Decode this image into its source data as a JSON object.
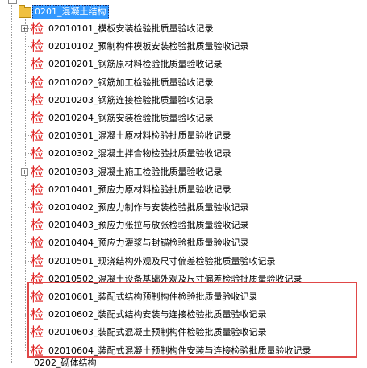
{
  "tree": {
    "parent": {
      "label": "0201_混凝土结构",
      "selected": true
    },
    "icon_char": "检",
    "items": [
      {
        "label": "02010101_模板安装检验批质量验收记录",
        "expander": "+"
      },
      {
        "label": "02010102_预制构件模板安装检验批质量验收记录"
      },
      {
        "label": "02010201_钢筋原材料检验批质量验收记录"
      },
      {
        "label": "02010202_钢筋加工检验批质量验收记录"
      },
      {
        "label": "02010203_钢筋连接检验批质量验收记录"
      },
      {
        "label": "02010204_钢筋安装检验批质量验收记录"
      },
      {
        "label": "02010301_混凝土原材料检验批质量验收记录"
      },
      {
        "label": "02010302_混凝土拌合物检验批质量验收记录"
      },
      {
        "label": "02010303_混凝土施工检验批质量验收记录",
        "expander": "+"
      },
      {
        "label": "02010401_预应力原材料检验批质量验收记录"
      },
      {
        "label": "02010402_预应力制作与安装检验批质量验收记录"
      },
      {
        "label": "02010403_预应力张拉与放张检验批质量验收记录"
      },
      {
        "label": "02010404_预应力灌浆与封锚检验批质量验收记录"
      },
      {
        "label": "02010501_现浇结构外观及尺寸偏差检验批质量验收记录"
      },
      {
        "label": "02010502_混凝土设备基础外观及尺寸偏差检验批质量验收记录"
      },
      {
        "label": "02010601_装配式结构预制构件检验批质量验收记录"
      },
      {
        "label": "02010602_装配式结构安装与连接检验批质量验收记录"
      },
      {
        "label": "02010603_装配式混凝土预制构件检验批质量验收记录"
      },
      {
        "label": "02010604_装配式混凝土预制构件安装与连接检验批质量验收记录"
      }
    ],
    "next_node": {
      "label": "0202_砌体结构"
    }
  },
  "colors": {
    "selection": "#3399ff",
    "icon": "#e02020",
    "highlight_border": "#e04848"
  }
}
